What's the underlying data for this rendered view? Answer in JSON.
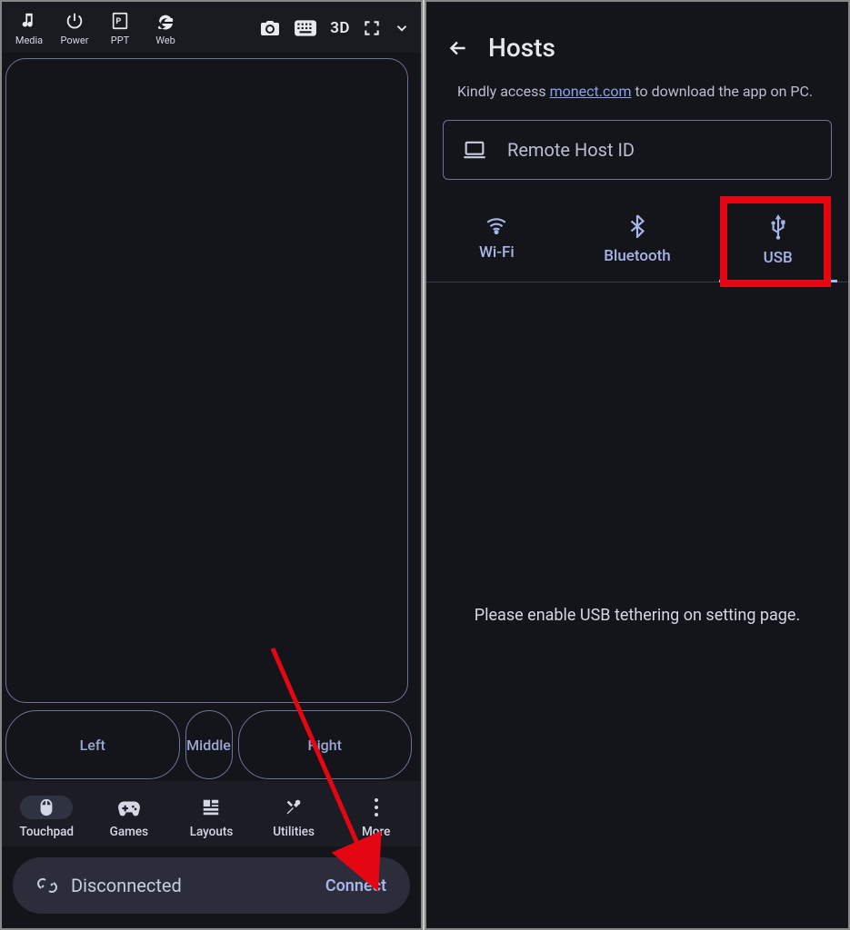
{
  "left": {
    "toolbar": [
      {
        "label": "Media",
        "icon": "music"
      },
      {
        "label": "Power",
        "icon": "power"
      },
      {
        "label": "PPT",
        "icon": "ppt"
      },
      {
        "label": "Web",
        "icon": "ie"
      }
    ],
    "toolbar_right_3d": "3D",
    "mouse_buttons": {
      "left": "Left",
      "middle": "Middle",
      "right": "Right"
    },
    "nav": [
      {
        "label": "Touchpad",
        "active": true
      },
      {
        "label": "Games"
      },
      {
        "label": "Layouts"
      },
      {
        "label": "Utilities"
      },
      {
        "label": "More"
      }
    ],
    "status": {
      "text": "Disconnected",
      "action": "Connect"
    }
  },
  "right": {
    "title": "Hosts",
    "subtitle_pre": "Kindly access ",
    "subtitle_link": "monect.com",
    "subtitle_post": " to download the app on PC.",
    "host_input_placeholder": "Remote Host ID",
    "tabs": [
      {
        "label": "Wi-Fi"
      },
      {
        "label": "Bluetooth"
      },
      {
        "label": "USB",
        "active": true,
        "highlighted": true
      }
    ],
    "usb_message": "Please enable USB tethering on setting page."
  }
}
